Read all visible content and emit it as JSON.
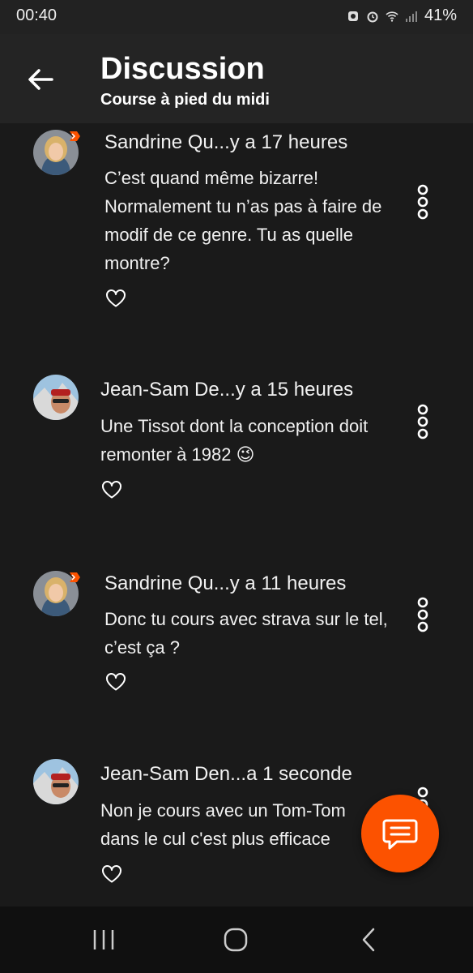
{
  "status": {
    "time": "00:40",
    "battery": "41%"
  },
  "header": {
    "title": "Discussion",
    "subtitle": "Course à pied du midi"
  },
  "comments": [
    {
      "author_time": "Sandrine Qu...y a 17 heures",
      "text": "C’est quand même bizarre! Normalement tu n’as pas à faire de modif de ce genre. Tu as quelle montre?"
    },
    {
      "author_time": "Jean-Sam De...y a 15 heures",
      "text": "Une Tissot dont la conception doit remonter à 1982 😉"
    },
    {
      "author_time": "Sandrine Qu...y a 11 heures",
      "text": "Donc tu cours avec strava sur le tel, c’est ça ?"
    },
    {
      "author_time": "Jean-Sam Den...a 1 seconde",
      "text": "Non je cours avec un Tom-Tom dans le cul c'est plus efficace"
    }
  ],
  "colors": {
    "accent": "#fc5200",
    "background": "#1a1a1a"
  }
}
